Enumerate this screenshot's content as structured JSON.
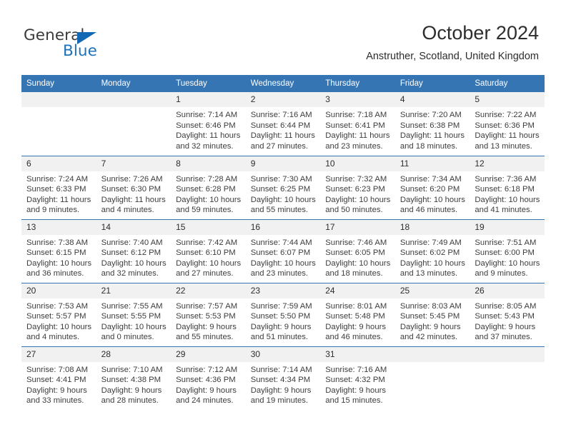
{
  "brand": {
    "word1": "General",
    "word2": "Blue",
    "triangle_color": "#1268b3",
    "blue_text_color": "#1e72bb"
  },
  "header": {
    "title": "October 2024",
    "subtitle": "Anstruther, Scotland, United Kingdom"
  },
  "theme": {
    "header_bar": "#3575b4",
    "daynum_bg": "#f1f1f1",
    "row_divider": "#3575b4",
    "text": "#3d3d3d"
  },
  "weekday_headers": [
    "Sunday",
    "Monday",
    "Tuesday",
    "Wednesday",
    "Thursday",
    "Friday",
    "Saturday"
  ],
  "weeks": [
    [
      {
        "day": "",
        "sunrise": "",
        "sunset": "",
        "daylight": "",
        "empty": true
      },
      {
        "day": "",
        "sunrise": "",
        "sunset": "",
        "daylight": "",
        "empty": true
      },
      {
        "day": "1",
        "sunrise": "Sunrise: 7:14 AM",
        "sunset": "Sunset: 6:46 PM",
        "daylight": "Daylight: 11 hours and 32 minutes."
      },
      {
        "day": "2",
        "sunrise": "Sunrise: 7:16 AM",
        "sunset": "Sunset: 6:44 PM",
        "daylight": "Daylight: 11 hours and 27 minutes."
      },
      {
        "day": "3",
        "sunrise": "Sunrise: 7:18 AM",
        "sunset": "Sunset: 6:41 PM",
        "daylight": "Daylight: 11 hours and 23 minutes."
      },
      {
        "day": "4",
        "sunrise": "Sunrise: 7:20 AM",
        "sunset": "Sunset: 6:38 PM",
        "daylight": "Daylight: 11 hours and 18 minutes."
      },
      {
        "day": "5",
        "sunrise": "Sunrise: 7:22 AM",
        "sunset": "Sunset: 6:36 PM",
        "daylight": "Daylight: 11 hours and 13 minutes."
      }
    ],
    [
      {
        "day": "6",
        "sunrise": "Sunrise: 7:24 AM",
        "sunset": "Sunset: 6:33 PM",
        "daylight": "Daylight: 11 hours and 9 minutes."
      },
      {
        "day": "7",
        "sunrise": "Sunrise: 7:26 AM",
        "sunset": "Sunset: 6:30 PM",
        "daylight": "Daylight: 11 hours and 4 minutes."
      },
      {
        "day": "8",
        "sunrise": "Sunrise: 7:28 AM",
        "sunset": "Sunset: 6:28 PM",
        "daylight": "Daylight: 10 hours and 59 minutes."
      },
      {
        "day": "9",
        "sunrise": "Sunrise: 7:30 AM",
        "sunset": "Sunset: 6:25 PM",
        "daylight": "Daylight: 10 hours and 55 minutes."
      },
      {
        "day": "10",
        "sunrise": "Sunrise: 7:32 AM",
        "sunset": "Sunset: 6:23 PM",
        "daylight": "Daylight: 10 hours and 50 minutes."
      },
      {
        "day": "11",
        "sunrise": "Sunrise: 7:34 AM",
        "sunset": "Sunset: 6:20 PM",
        "daylight": "Daylight: 10 hours and 46 minutes."
      },
      {
        "day": "12",
        "sunrise": "Sunrise: 7:36 AM",
        "sunset": "Sunset: 6:18 PM",
        "daylight": "Daylight: 10 hours and 41 minutes."
      }
    ],
    [
      {
        "day": "13",
        "sunrise": "Sunrise: 7:38 AM",
        "sunset": "Sunset: 6:15 PM",
        "daylight": "Daylight: 10 hours and 36 minutes."
      },
      {
        "day": "14",
        "sunrise": "Sunrise: 7:40 AM",
        "sunset": "Sunset: 6:12 PM",
        "daylight": "Daylight: 10 hours and 32 minutes."
      },
      {
        "day": "15",
        "sunrise": "Sunrise: 7:42 AM",
        "sunset": "Sunset: 6:10 PM",
        "daylight": "Daylight: 10 hours and 27 minutes."
      },
      {
        "day": "16",
        "sunrise": "Sunrise: 7:44 AM",
        "sunset": "Sunset: 6:07 PM",
        "daylight": "Daylight: 10 hours and 23 minutes."
      },
      {
        "day": "17",
        "sunrise": "Sunrise: 7:46 AM",
        "sunset": "Sunset: 6:05 PM",
        "daylight": "Daylight: 10 hours and 18 minutes."
      },
      {
        "day": "18",
        "sunrise": "Sunrise: 7:49 AM",
        "sunset": "Sunset: 6:02 PM",
        "daylight": "Daylight: 10 hours and 13 minutes."
      },
      {
        "day": "19",
        "sunrise": "Sunrise: 7:51 AM",
        "sunset": "Sunset: 6:00 PM",
        "daylight": "Daylight: 10 hours and 9 minutes."
      }
    ],
    [
      {
        "day": "20",
        "sunrise": "Sunrise: 7:53 AM",
        "sunset": "Sunset: 5:57 PM",
        "daylight": "Daylight: 10 hours and 4 minutes."
      },
      {
        "day": "21",
        "sunrise": "Sunrise: 7:55 AM",
        "sunset": "Sunset: 5:55 PM",
        "daylight": "Daylight: 10 hours and 0 minutes."
      },
      {
        "day": "22",
        "sunrise": "Sunrise: 7:57 AM",
        "sunset": "Sunset: 5:53 PM",
        "daylight": "Daylight: 9 hours and 55 minutes."
      },
      {
        "day": "23",
        "sunrise": "Sunrise: 7:59 AM",
        "sunset": "Sunset: 5:50 PM",
        "daylight": "Daylight: 9 hours and 51 minutes."
      },
      {
        "day": "24",
        "sunrise": "Sunrise: 8:01 AM",
        "sunset": "Sunset: 5:48 PM",
        "daylight": "Daylight: 9 hours and 46 minutes."
      },
      {
        "day": "25",
        "sunrise": "Sunrise: 8:03 AM",
        "sunset": "Sunset: 5:45 PM",
        "daylight": "Daylight: 9 hours and 42 minutes."
      },
      {
        "day": "26",
        "sunrise": "Sunrise: 8:05 AM",
        "sunset": "Sunset: 5:43 PM",
        "daylight": "Daylight: 9 hours and 37 minutes."
      }
    ],
    [
      {
        "day": "27",
        "sunrise": "Sunrise: 7:08 AM",
        "sunset": "Sunset: 4:41 PM",
        "daylight": "Daylight: 9 hours and 33 minutes."
      },
      {
        "day": "28",
        "sunrise": "Sunrise: 7:10 AM",
        "sunset": "Sunset: 4:38 PM",
        "daylight": "Daylight: 9 hours and 28 minutes."
      },
      {
        "day": "29",
        "sunrise": "Sunrise: 7:12 AM",
        "sunset": "Sunset: 4:36 PM",
        "daylight": "Daylight: 9 hours and 24 minutes."
      },
      {
        "day": "30",
        "sunrise": "Sunrise: 7:14 AM",
        "sunset": "Sunset: 4:34 PM",
        "daylight": "Daylight: 9 hours and 19 minutes."
      },
      {
        "day": "31",
        "sunrise": "Sunrise: 7:16 AM",
        "sunset": "Sunset: 4:32 PM",
        "daylight": "Daylight: 9 hours and 15 minutes."
      },
      {
        "day": "",
        "sunrise": "",
        "sunset": "",
        "daylight": "",
        "empty": true
      },
      {
        "day": "",
        "sunrise": "",
        "sunset": "",
        "daylight": "",
        "empty": true
      }
    ]
  ]
}
